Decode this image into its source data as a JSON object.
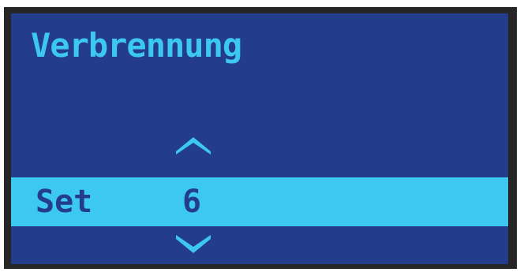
{
  "screen": {
    "title": "Verbrennung",
    "setting": {
      "label": "Set",
      "value": "6"
    },
    "icons": {
      "up": "arrow-up-icon",
      "down": "arrow-down-icon"
    },
    "colors": {
      "background": "#243c8c",
      "accent": "#3cc8f0",
      "bezel": "#262626"
    }
  }
}
